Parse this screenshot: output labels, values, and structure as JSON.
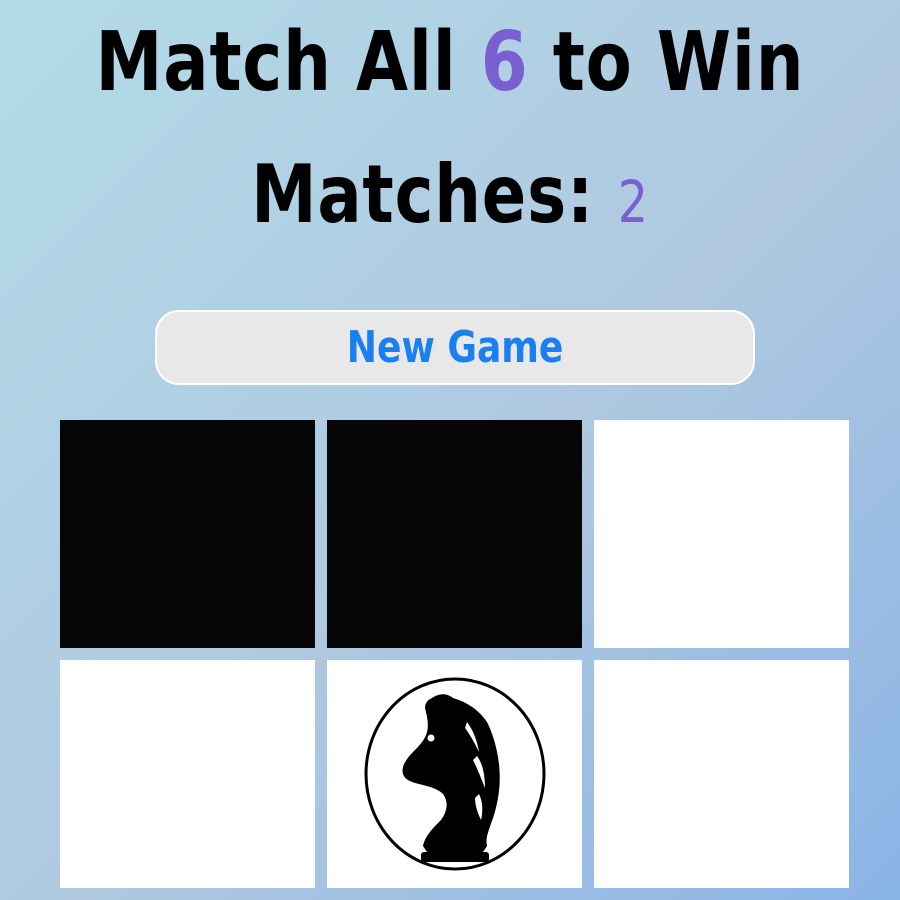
{
  "header": {
    "win_prefix": "Match All",
    "win_count": "6",
    "win_suffix": "to Win",
    "matches_label": "Matches:",
    "matches_value": "2"
  },
  "controls": {
    "new_game_label": "New Game"
  },
  "colors": {
    "accent": "#7a5fd1",
    "button_text": "#1a7ff0",
    "card_back": "#060606",
    "card_front": "#ffffff"
  },
  "board": {
    "rows": 2,
    "cols": 3,
    "cards": [
      {
        "state": "face-down",
        "icon": ""
      },
      {
        "state": "face-down",
        "icon": ""
      },
      {
        "state": "face-up",
        "icon": ""
      },
      {
        "state": "face-up",
        "icon": ""
      },
      {
        "state": "face-up",
        "icon": "chess-knight-icon"
      },
      {
        "state": "face-up",
        "icon": ""
      }
    ]
  }
}
